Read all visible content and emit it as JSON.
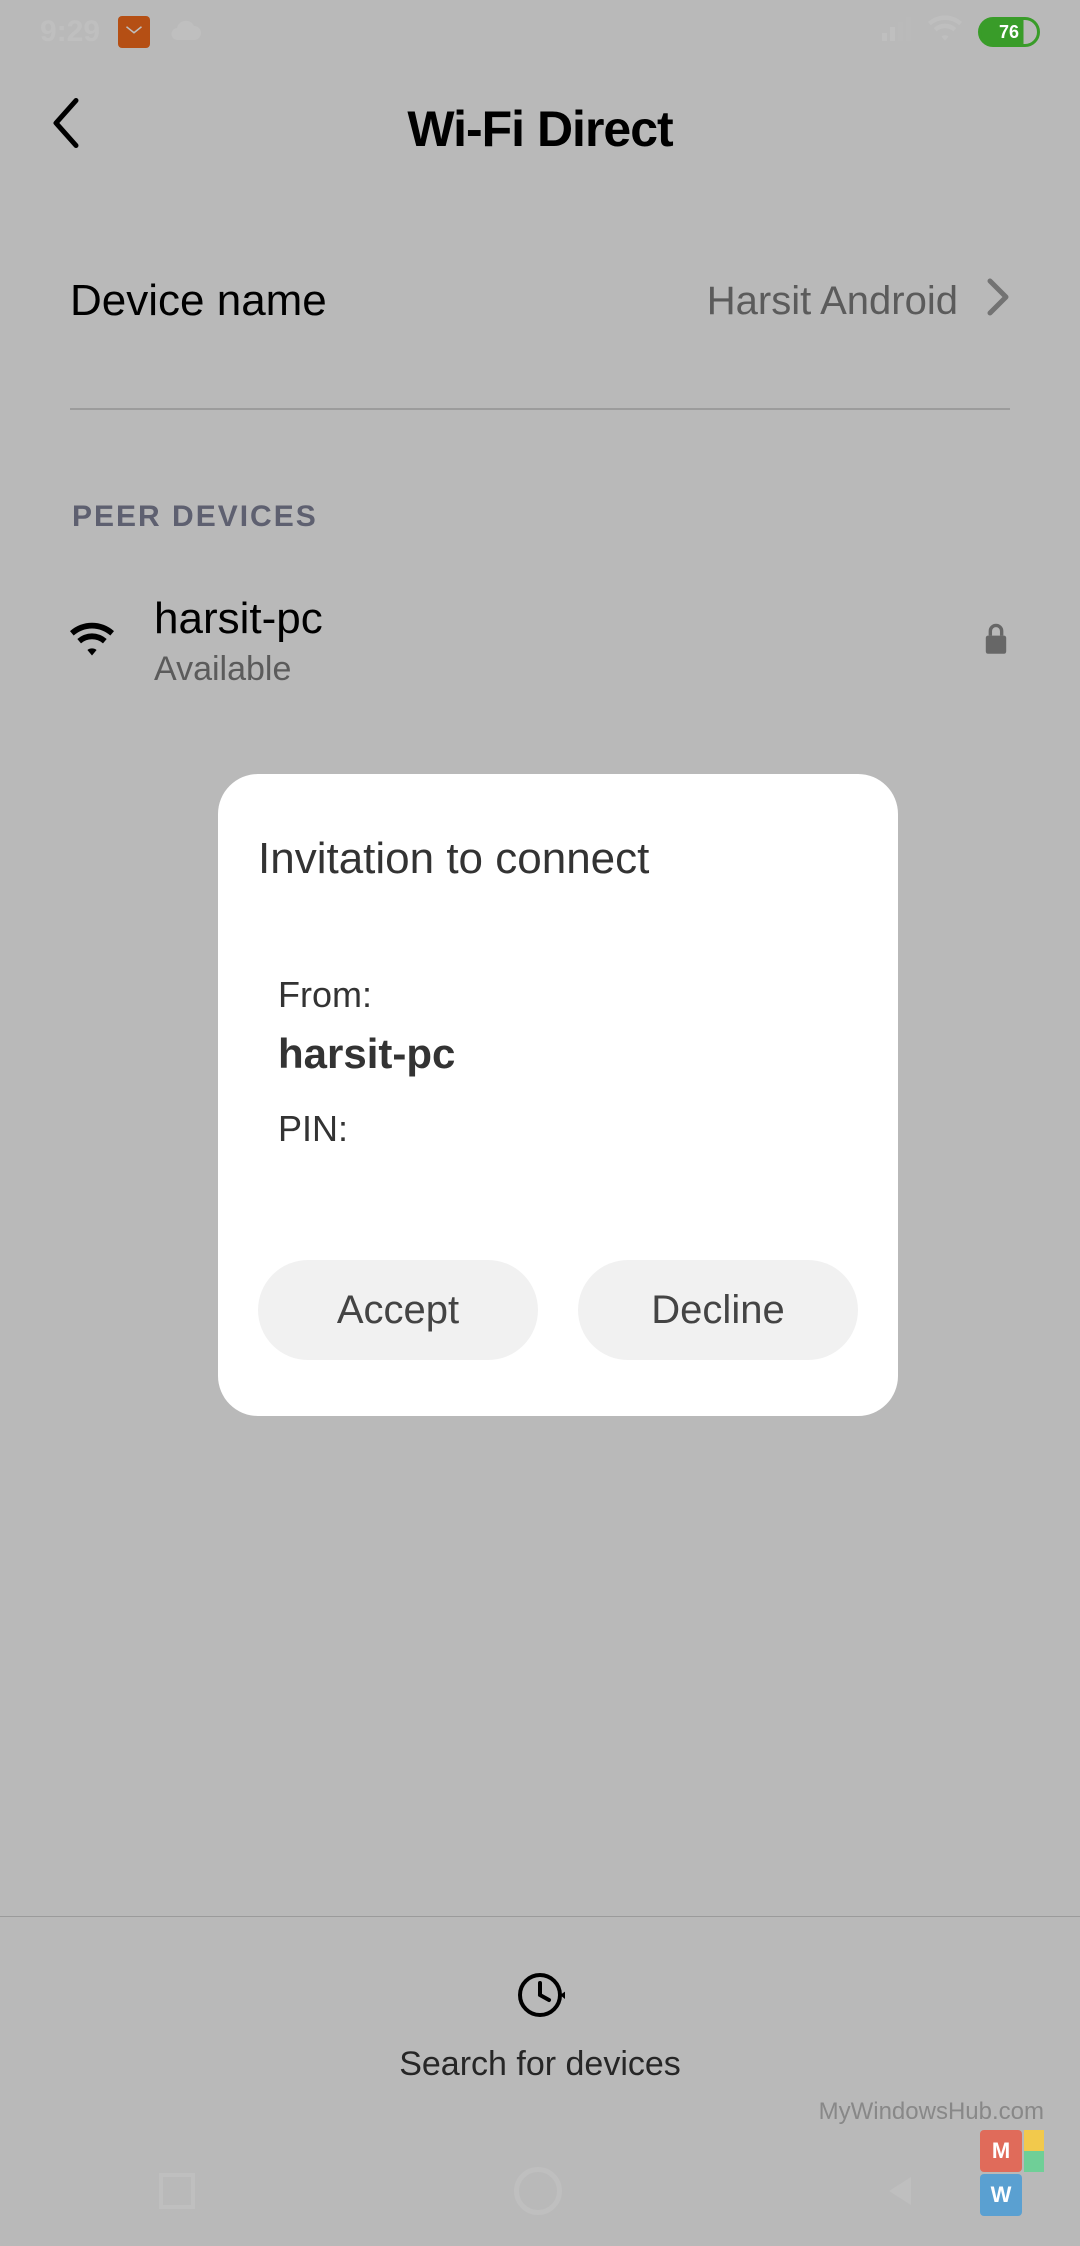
{
  "status_bar": {
    "time": "9:29",
    "battery_pct": "76"
  },
  "header": {
    "title": "Wi-Fi Direct"
  },
  "device_name_row": {
    "label": "Device name",
    "value": "Harsit Android"
  },
  "sections": {
    "peer_devices_title": "PEER DEVICES"
  },
  "peer_devices": [
    {
      "name": "harsit-pc",
      "status": "Available"
    }
  ],
  "bottom_action": {
    "label": "Search for devices"
  },
  "dialog": {
    "title": "Invitation to connect",
    "from_label": "From:",
    "from_name": "harsit-pc",
    "pin_label": "PIN:",
    "accept": "Accept",
    "decline": "Decline"
  },
  "watermark": {
    "text": "MyWindowsHub.com"
  }
}
